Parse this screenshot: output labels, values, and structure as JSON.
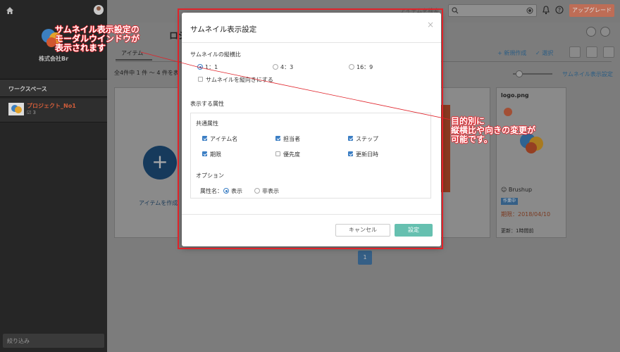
{
  "sidebar": {
    "company": "株式会社Br",
    "workspace_header": "ワークスペース",
    "project": {
      "name": "プロジェクト_No1",
      "count": "3"
    },
    "filter_placeholder": "絞り込み"
  },
  "header": {
    "search_hint": "アイテムを検索",
    "upgrade_label": "アップグレード"
  },
  "main": {
    "project_title": "ロジェクト",
    "tab_label": "アイテム",
    "count_text": "全4件中 1 件 ～ 4 件を表",
    "new_label": "+ 新規作成",
    "select_label": "✓ 選択",
    "thumb_setting_label": "サムネイル表示設定",
    "add_item_label": "アイテムを作成",
    "page_number": "1",
    "logo_card": {
      "name": "logo.png",
      "owner": "Brushup",
      "status": "作業中",
      "due": "期限：2018/04/10",
      "updated": "更新：1時間前"
    }
  },
  "modal": {
    "title": "サムネイル表示設定",
    "close": "×",
    "ratio_label": "サムネイルの縦横比",
    "ratios": [
      "1：1",
      "4：3",
      "16：9"
    ],
    "selected_ratio": "1：1",
    "vertical_label": "サムネイルを縦向きにする",
    "attributes_label": "表示する属性",
    "common_label": "共通属性",
    "attrs": [
      {
        "label": "アイテム名",
        "checked": true
      },
      {
        "label": "担当者",
        "checked": true
      },
      {
        "label": "ステップ",
        "checked": true
      },
      {
        "label": "期限",
        "checked": true
      },
      {
        "label": "優先度",
        "checked": false
      },
      {
        "label": "更新日時",
        "checked": true
      }
    ],
    "option_label": "オプション",
    "attr_name_label": "属性名：",
    "attr_name_options": [
      "表示",
      "非表示"
    ],
    "cancel_label": "キャンセル",
    "ok_label": "設定"
  },
  "annotations": {
    "modal_note": "サムネイル表示設定の\nモーダルウインドウが\n表示されます",
    "ratio_note": "目的別に\n縦横比や向きの変更が\n可能です。",
    "color": "#e0232a"
  }
}
